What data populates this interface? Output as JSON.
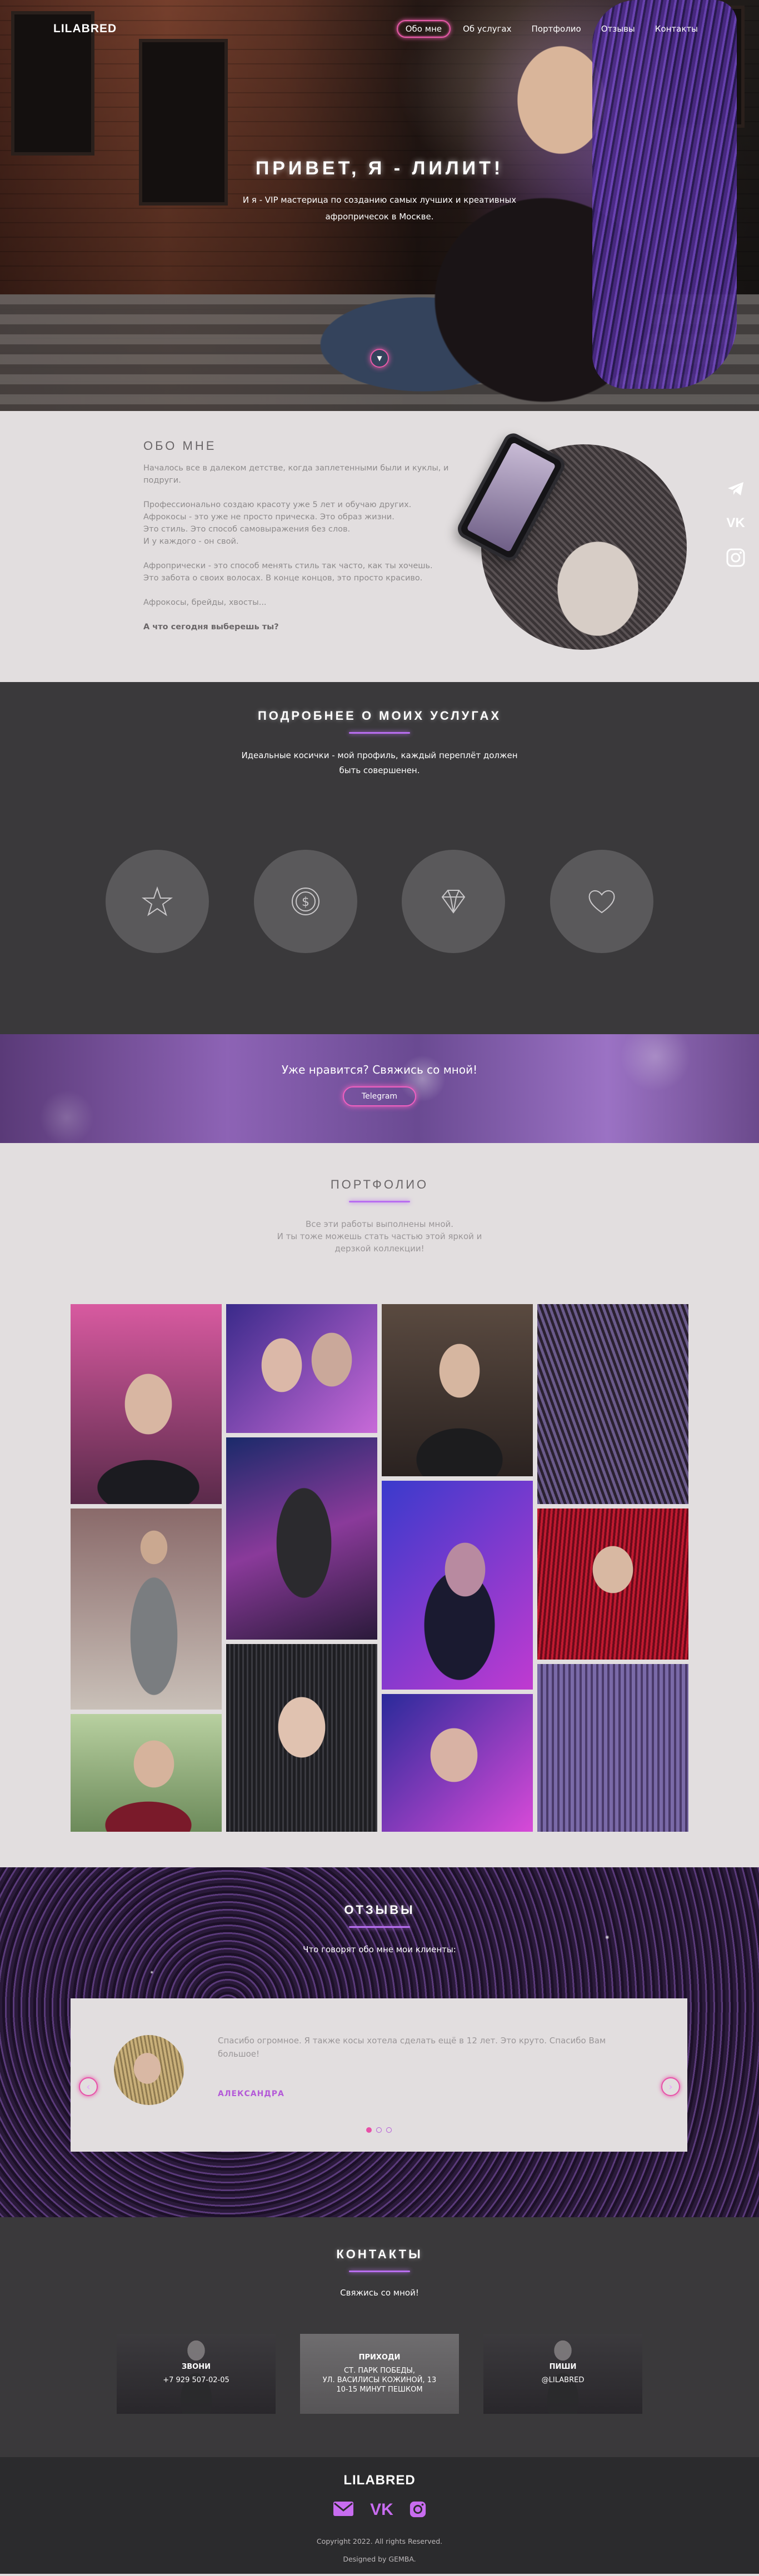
{
  "brand": "LILABRED",
  "nav": [
    "Обо мне",
    "Об услугах",
    "Портфолио",
    "Отзывы",
    "Контакты"
  ],
  "hero": {
    "title": "ПРИВЕТ, Я - ЛИЛИТ!",
    "subtitle": "И я - VIP мастерица по созданию самых лучших и креативных афропричесок в Москве."
  },
  "about": {
    "title": "ОБО МНЕ",
    "paragraphs": [
      "Началось все в далеком детстве, когда заплетенными были и куклы, и подруги.",
      "Профессионально создаю красоту уже 5 лет и обучаю других.\nАфрокосы - это уже не просто прическа. Это образ жизни.\nЭто стиль. Это способ самовыражения без слов.\nИ у каждого - он свой.",
      "Афропрически - это способ менять стиль так часто, как ты хочешь.\nЭто забота о своих волосах. В конце концов, это просто красиво.",
      "Афрокосы, брейды, хвосты..."
    ],
    "question": "А что сегодня выберешь ты?"
  },
  "social_side": [
    "telegram-icon",
    "vk-icon",
    "instagram-icon"
  ],
  "services": {
    "title": "ПОДРОБНЕЕ О МОИХ УСЛУГАХ",
    "subtitle": "Идеальные косички - мой профиль, каждый переплёт должен быть совершенен.",
    "icons": [
      "star-icon",
      "coin-icon",
      "diamond-icon",
      "heart-icon"
    ]
  },
  "cta": {
    "text": "Уже нравится? Свяжись со мной!",
    "button": "Telegram"
  },
  "portfolio": {
    "title": "ПОРТФОЛИО",
    "subtitle": "Все эти работы выполнены мной.\nИ ты тоже можешь стать частью этой яркой и дерзкой коллекции!"
  },
  "reviews": {
    "title": "ОТЗЫВЫ",
    "subtitle": "Что говорят обо мне мои клиенты:",
    "quote": "Спасибо огромное. Я также косы хотела сделать ещё в 12 лет. Это круто. Спасибо Вам большое!",
    "author": "АЛЕКСАНДРА",
    "slides_total": 3,
    "active_slide": 1
  },
  "contacts": {
    "title": "КОНТАКТЫ",
    "subtitle": "Свяжись со мной!",
    "cards": [
      {
        "title": "ЗВОНИ",
        "value": "+7 929 507-02-05"
      },
      {
        "title": "ПРИХОДИ",
        "value": "СТ. ПАРК ПОБЕДЫ,\nУЛ. ВАСИЛИСЫ КОЖИНОЙ, 13\n10-15 МИНУТ ПЕШКОМ"
      },
      {
        "title": "ПИШИ",
        "value": "@LILABRED"
      }
    ]
  },
  "footer": {
    "brand": "LILABRED",
    "icons": [
      "mail-icon",
      "vk-icon",
      "instagram-icon"
    ],
    "copyright": "Copyright 2022. All rights Reserved.",
    "designed": "Designed by GEMBA."
  },
  "colors": {
    "accent_pink": "#e85aa8",
    "accent_purple": "#b86ef0",
    "dark_bg": "#3a393b",
    "light_bg": "#e2dedf"
  }
}
